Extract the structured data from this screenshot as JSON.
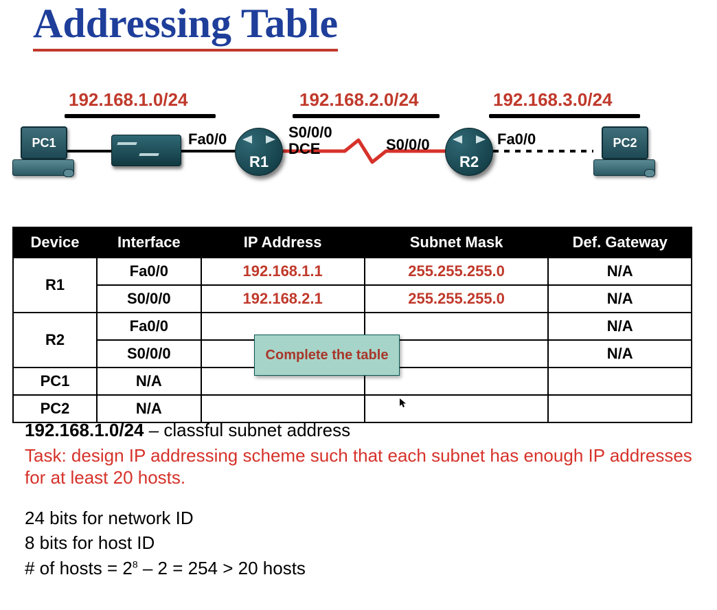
{
  "title": "Addressing Table",
  "topology": {
    "networks": [
      {
        "label": "192.168.1.0/24"
      },
      {
        "label": "192.168.2.0/24"
      },
      {
        "label": "192.168.3.0/24"
      }
    ],
    "devices": {
      "pc1": "PC1",
      "pc2": "PC2",
      "r1": "R1",
      "r2": "R2"
    },
    "interfaces": {
      "r1_fa": "Fa0/0",
      "r1_s0": "S0/0/0",
      "r1_dce": "DCE",
      "r2_s0": "S0/0/0",
      "r2_fa": "Fa0/0"
    }
  },
  "table": {
    "headers": {
      "device": "Device",
      "interface": "Interface",
      "ip": "IP Address",
      "mask": "Subnet Mask",
      "gateway": "Def. Gateway"
    },
    "rows": [
      {
        "device": "R1",
        "iface": "Fa0/0",
        "ip": "192.168.1.1",
        "mask": "255.255.255.0",
        "gw": "N/A",
        "red": true
      },
      {
        "device": "",
        "iface": "S0/0/0",
        "ip": "192.168.2.1",
        "mask": "255.255.255.0",
        "gw": "N/A",
        "red": true
      },
      {
        "device": "R2",
        "iface": "Fa0/0",
        "ip": "",
        "mask": "",
        "gw": "N/A"
      },
      {
        "device": "",
        "iface": "S0/0/0",
        "ip": "",
        "mask": "",
        "gw": "N/A"
      },
      {
        "device": "PC1",
        "iface": "N/A",
        "ip": "",
        "mask": "",
        "gw": ""
      },
      {
        "device": "PC2",
        "iface": "N/A",
        "ip": "",
        "mask": "",
        "gw": ""
      }
    ],
    "callout": "Complete the table"
  },
  "notes": {
    "line1_bold": "192.168.1.0/24",
    "line1_rest": "   –   classful subnet address",
    "task": "Task: design IP addressing scheme such that each subnet has enough IP addresses for at least 20 hosts.",
    "bits_net": "24 bits for network ID",
    "bits_host": "8 bits for host ID",
    "hosts_prefix": "# of hosts = 2",
    "hosts_exp": "8",
    "hosts_suffix": " – 2 = 254 > 20 hosts"
  }
}
